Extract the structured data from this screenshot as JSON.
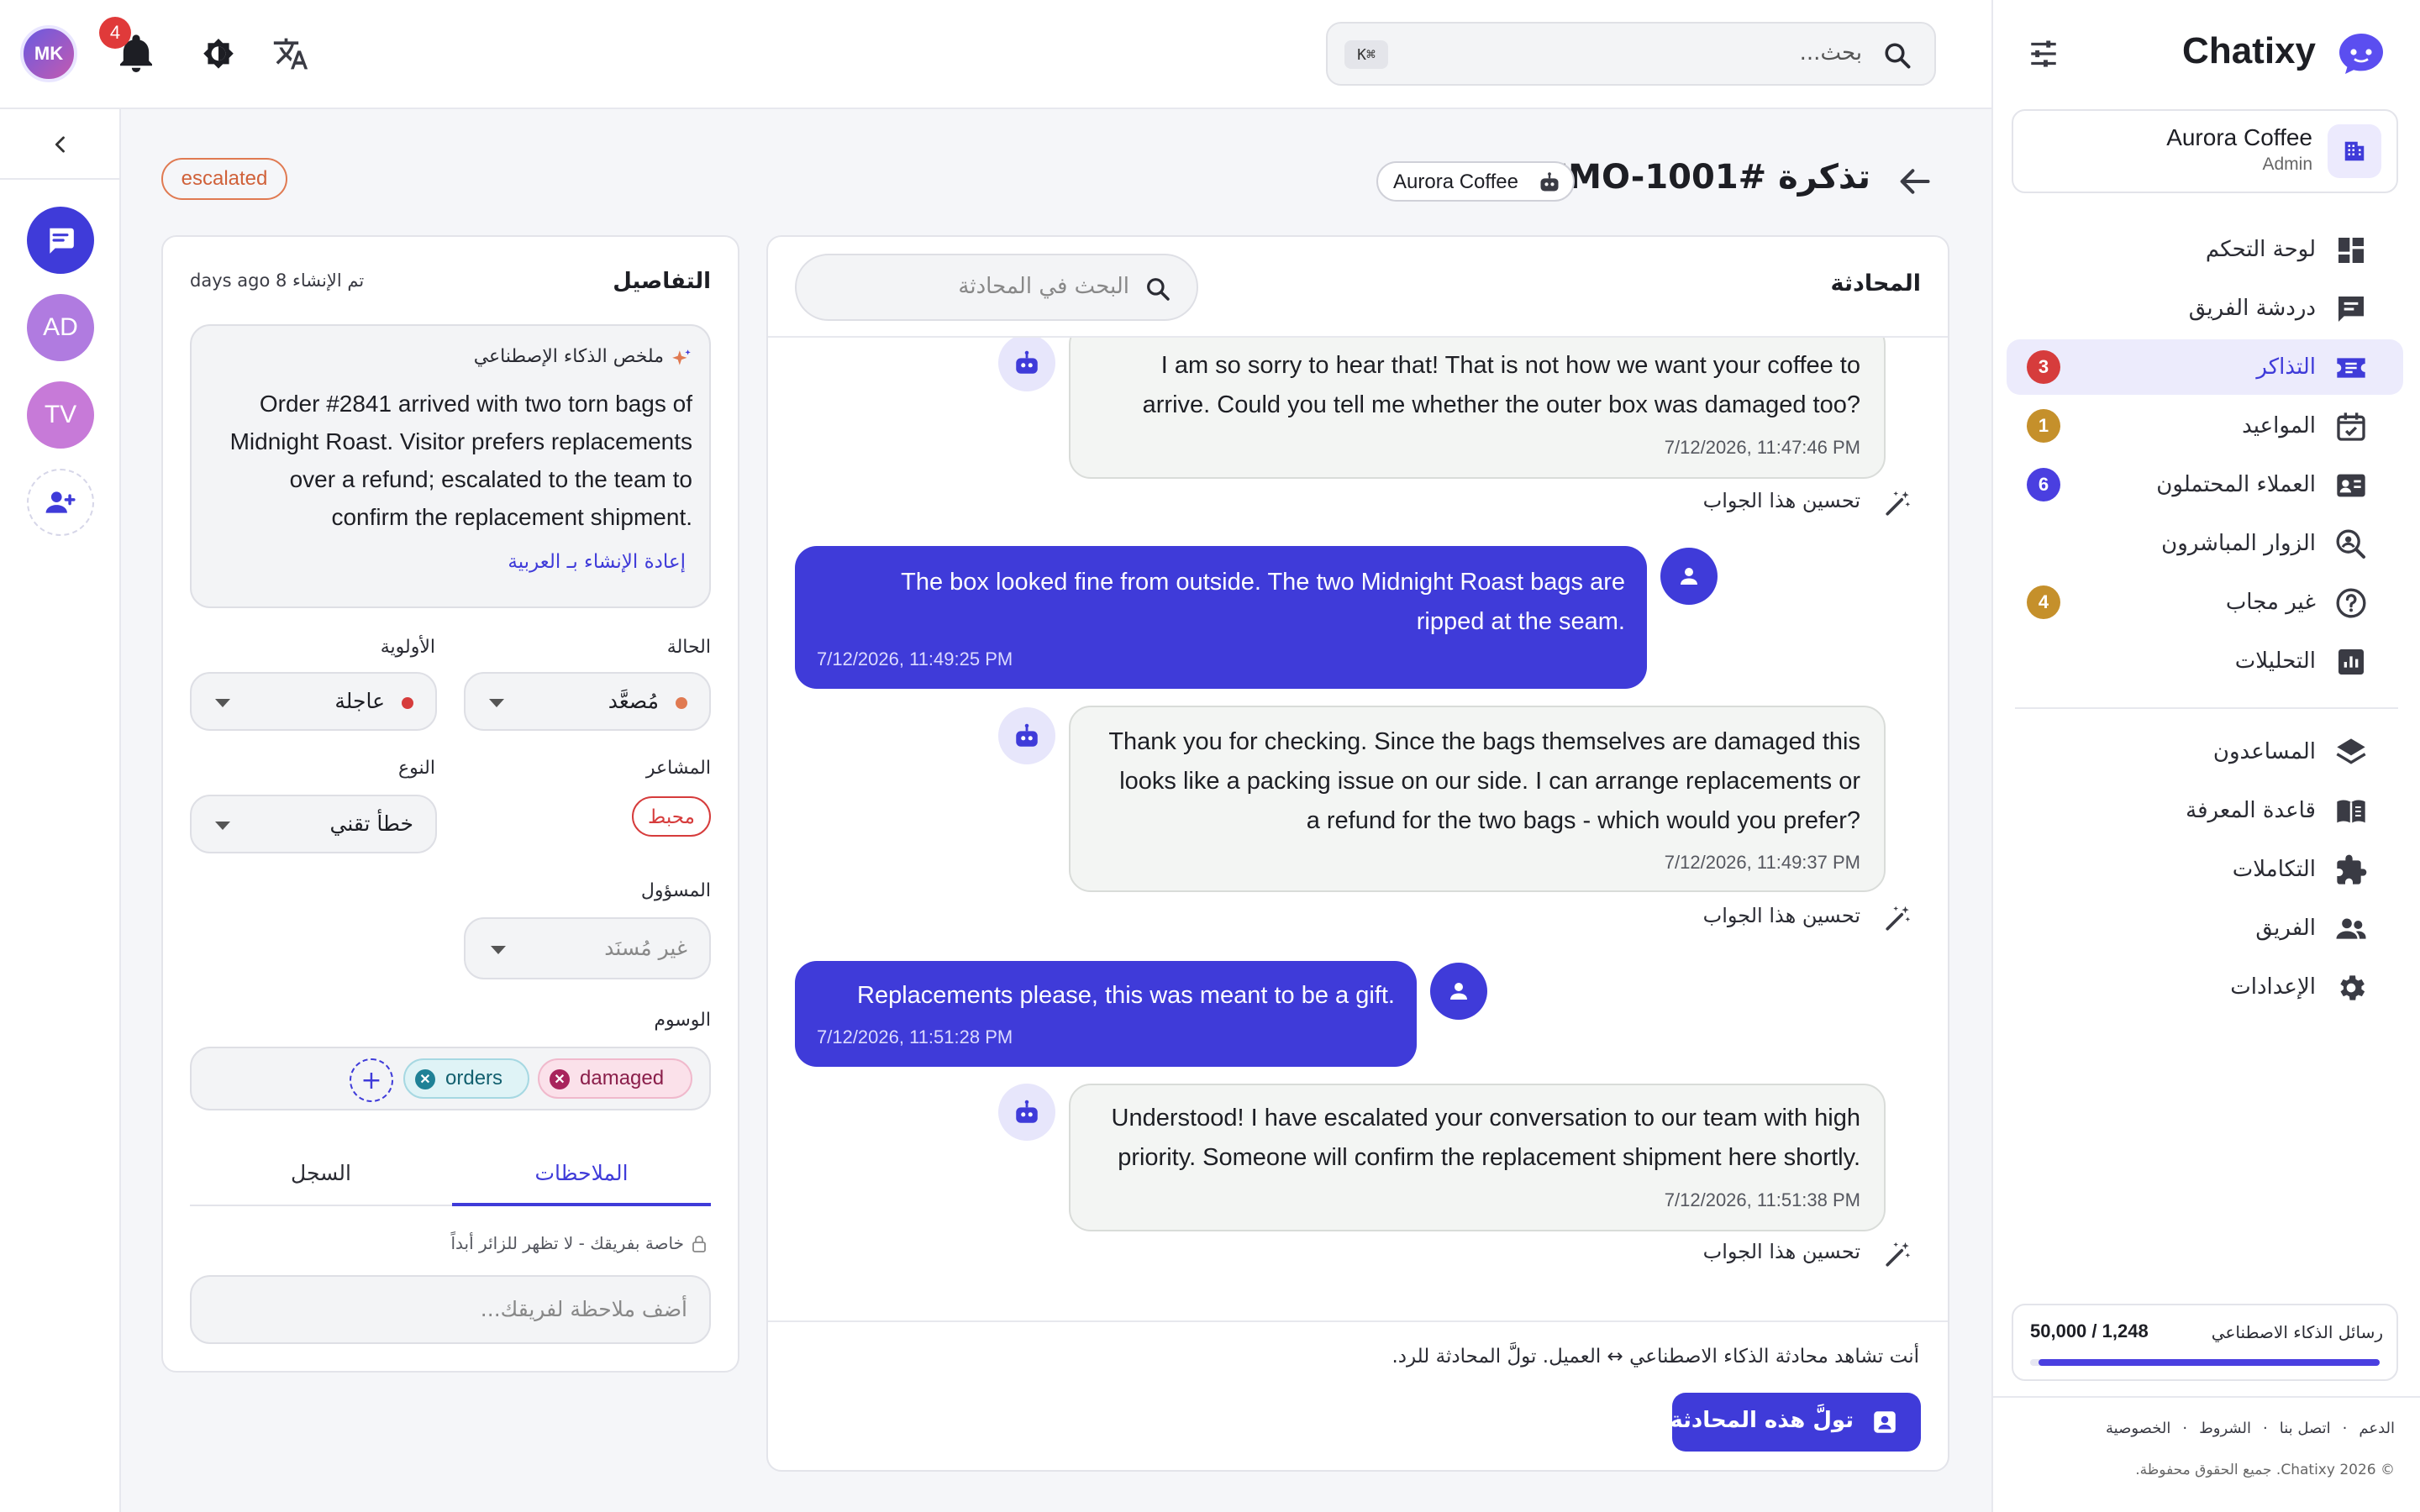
{
  "app": {
    "name": "Chatixy"
  },
  "topbar": {
    "user_initials": "MK",
    "notification_count": "4",
    "search_placeholder": "بحث...",
    "search_shortcut": "⌘K"
  },
  "workspace": {
    "name": "Aurora Coffee",
    "role": "Admin"
  },
  "sidebar": {
    "items": [
      {
        "label": "لوحة التحكم",
        "icon": "dashboard-icon"
      },
      {
        "label": "دردشة الفريق",
        "icon": "chat-icon"
      },
      {
        "label": "التذاكر",
        "icon": "ticket-icon",
        "badge": "3",
        "active": true
      },
      {
        "label": "المواعيد",
        "icon": "calendar-icon",
        "badge": "1"
      },
      {
        "label": "العملاء المحتملون",
        "icon": "contact-card-icon",
        "badge": "6"
      },
      {
        "label": "الزوار المباشرون",
        "icon": "visitor-search-icon"
      },
      {
        "label": "غير مجاب",
        "icon": "question-icon",
        "badge": "4"
      },
      {
        "label": "التحليلات",
        "icon": "analytics-icon"
      },
      {
        "label": "المساعدون",
        "icon": "layers-icon"
      },
      {
        "label": "قاعدة المعرفة",
        "icon": "book-icon"
      },
      {
        "label": "التكاملات",
        "icon": "puzzle-icon"
      },
      {
        "label": "الفريق",
        "icon": "team-icon"
      },
      {
        "label": "الإعدادات",
        "icon": "gear-icon"
      }
    ],
    "usage_label": "رسائل الذكاء الاصطناعي",
    "usage_value": "1,248 / 50,000",
    "usage_fraction": 0.975,
    "footer_links": [
      "الدعم",
      "اتصل بنا",
      "الشروط",
      "الخصوصية"
    ],
    "copyright": "© 2026 Chatixy. جميع الحقوق محفوظة."
  },
  "rail": {
    "avatars": [
      "AD",
      "TV"
    ]
  },
  "ticket": {
    "title": "تذكرة #DEMO-1001",
    "workspace_chip": "Aurora Coffee",
    "status_badge": "escalated"
  },
  "conversation": {
    "heading": "المحادثة",
    "search_placeholder": "البحث في المحادثة",
    "improve_label": "تحسين هذا الجواب",
    "messages": [
      {
        "from": "bot",
        "lines": [
          "I am so sorry to hear that! That is not how we want your coffee to",
          "arrive. Could you tell me whether the outer box was damaged too?"
        ],
        "time": "7/12/2026, 11:47:46 PM"
      },
      {
        "from": "user",
        "lines": [
          "The box looked fine from outside. The two Midnight Roast bags are",
          "ripped at the seam."
        ],
        "time": "7/12/2026, 11:49:25 PM"
      },
      {
        "from": "bot",
        "lines": [
          "Thank you for checking. Since the bags themselves are damaged this",
          "looks like a packing issue on our side. I can arrange replacements or",
          "a refund for the two bags - which would you prefer?"
        ],
        "time": "7/12/2026, 11:49:37 PM"
      },
      {
        "from": "user",
        "lines": [
          "Replacements please, this was meant to be a gift."
        ],
        "time": "7/12/2026, 11:51:28 PM"
      },
      {
        "from": "bot",
        "lines": [
          "Understood! I have escalated your conversation to our team with high",
          "priority. Someone will confirm the replacement shipment here shortly."
        ],
        "time": "7/12/2026, 11:51:38 PM"
      }
    ],
    "footer_note": "أنت تشاهد محادثة الذكاء الاصطناعي ↔ العميل. تولَّ المحادثة للرد.",
    "takeover_button": "تولَّ هذه المحادثة"
  },
  "details": {
    "heading": "التفاصيل",
    "created": "تم الإنشاء 8 days ago",
    "ai_summary_label": "ملخص الذكاء الإصطناعي",
    "ai_summary_lines": [
      "Order #2841 arrived with two torn bags of",
      "Midnight Roast. Visitor prefers replacements",
      "over a refund; escalated to the team to",
      "confirm the replacement shipment."
    ],
    "regenerate_link": "إعادة الإنشاء بـ العربية",
    "status_label": "الحالة",
    "status_value": "مُصعَّد",
    "priority_label": "الأولوية",
    "priority_value": "عاجلة",
    "sentiment_label": "المشاعر",
    "sentiment_value": "محبط",
    "type_label": "النوع",
    "type_value": "خطأ تقني",
    "assignee_label": "المسؤول",
    "assignee_value": "غير مُسنَد",
    "tags_label": "الوسوم",
    "tags": [
      "damaged",
      "orders"
    ],
    "tabs": [
      "الملاحظات",
      "السجل"
    ],
    "notes_privacy": "خاصة بفريقك - لا تظهر للزائر أبداً",
    "note_placeholder": "أضف ملاحظة لفريقك..."
  },
  "colors": {
    "accent": "#3f3bd9",
    "danger": "#d63c3c",
    "warning": "#c5902b",
    "escalated": "#e07a52"
  }
}
